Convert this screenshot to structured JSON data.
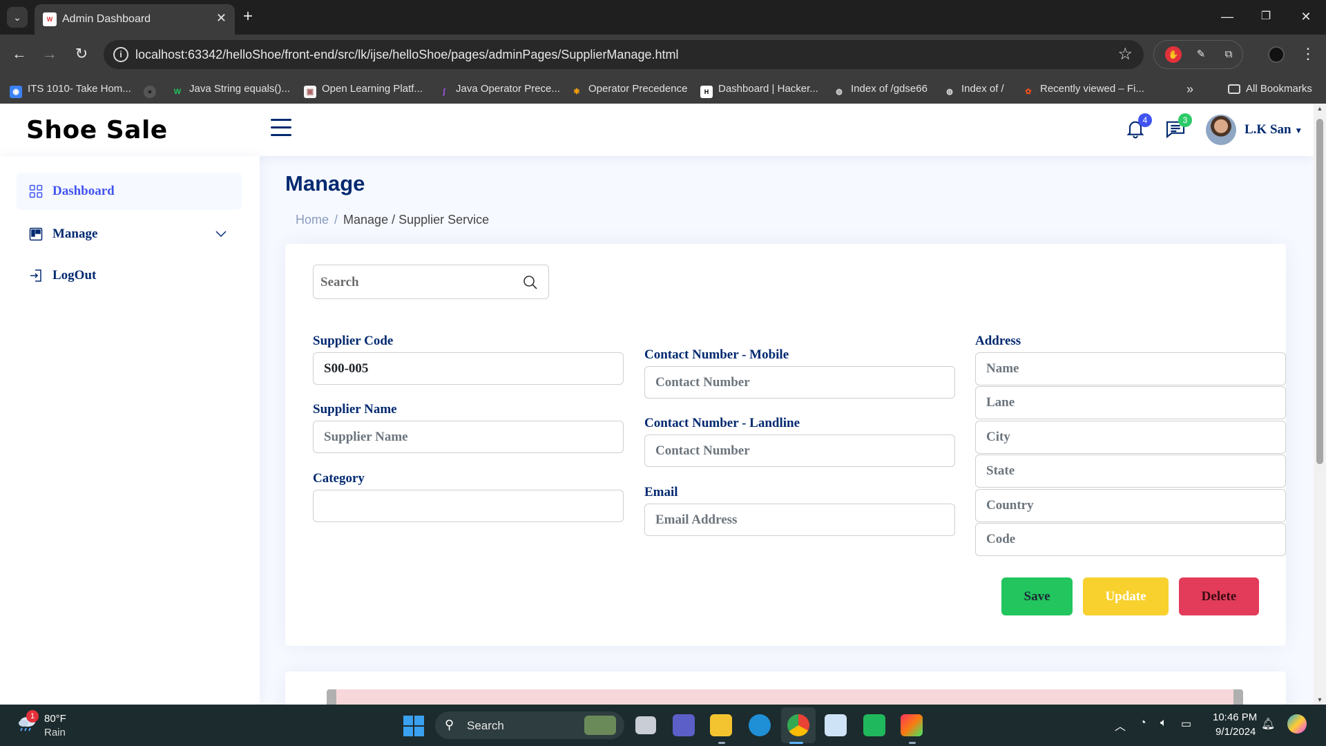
{
  "browser": {
    "tab_title": "Admin Dashboard",
    "url": "localhost:63342/helloShoe/front-end/src/lk/ijse/helloShoe/pages/adminPages/SupplierManage.html",
    "bookmarks": [
      "ITS 1010- Take Hom...",
      "",
      "Java String equals()...",
      "Open Learning Platf...",
      "Java Operator Prece...",
      "Operator Precedence",
      "Dashboard | Hacker...",
      "Index of /gdse66",
      "Index of /",
      "Recently viewed – Fi..."
    ],
    "all_bookmarks": "All Bookmarks"
  },
  "header": {
    "brand": "Shoe Sale",
    "notifications_count": "4",
    "messages_count": "3",
    "profile_name": "L.K San"
  },
  "sidebar": {
    "items": [
      {
        "label": "Dashboard",
        "icon": "grid-icon"
      },
      {
        "label": "Manage",
        "icon": "layout-icon"
      },
      {
        "label": "LogOut",
        "icon": "logout-icon"
      }
    ]
  },
  "page": {
    "title": "Manage",
    "breadcrumb_home": "Home",
    "breadcrumb_separator": "/",
    "breadcrumb_current": "Manage / Supplier Service"
  },
  "form": {
    "search_placeholder": "Search",
    "supplier_code_label": "Supplier Code",
    "supplier_code_value": "S00-005",
    "supplier_name_label": "Supplier Name",
    "supplier_name_placeholder": "Supplier Name",
    "category_label": "Category",
    "category_value": "",
    "mobile_label": "Contact Number - Mobile",
    "mobile_placeholder": "Contact Number",
    "landline_label": "Contact Number - Landline",
    "landline_placeholder": "Contact Number",
    "email_label": "Email",
    "email_placeholder": "Email Address",
    "address_label": "Address",
    "address_fields": [
      "Name",
      "Lane",
      "City",
      "State",
      "Country",
      "Code"
    ],
    "save_label": "Save",
    "update_label": "Update",
    "delete_label": "Delete"
  },
  "taskbar": {
    "weather_temp": "80°F",
    "weather_desc": "Rain",
    "weather_alerts": "1",
    "search_label": "Search",
    "time": "10:46 PM",
    "date": "9/1/2024"
  },
  "colors": {
    "primary": "#4154f1",
    "navy": "#012970",
    "save": "#22c55e",
    "update": "#f8d12f",
    "delete": "#e23c5a"
  }
}
